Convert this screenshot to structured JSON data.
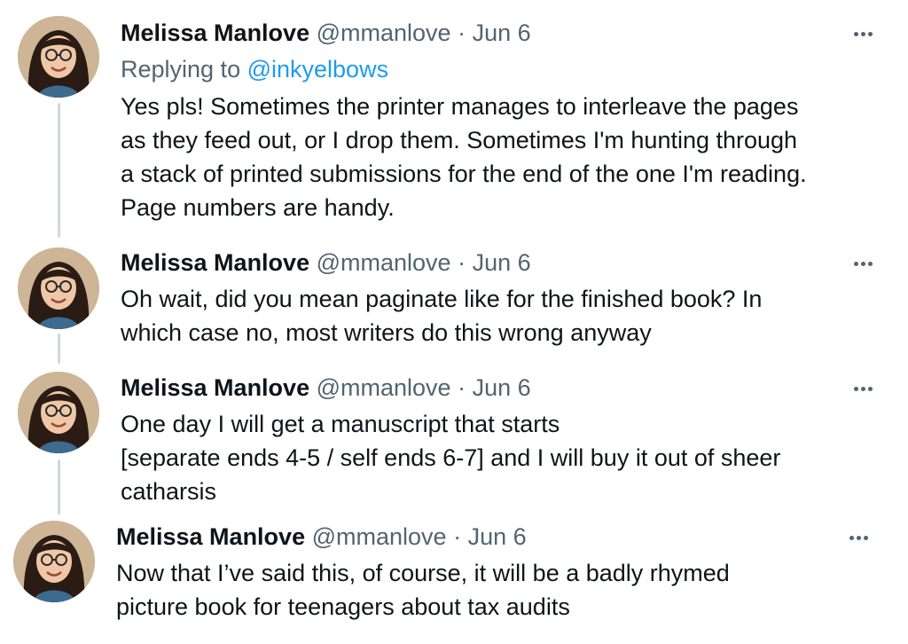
{
  "tweets": [
    {
      "name": "Melissa Manlove",
      "handle": "@mmanlove",
      "separator": "·",
      "date": "Jun 6",
      "replying_prefix": "Replying to ",
      "replying_mention": "@inkyelbows",
      "lines": [
        "Yes pls! Sometimes the printer manages to interleave the pages",
        "as they feed out, or I drop them. Sometimes I'm hunting through",
        "a stack of printed submissions for the end of the one I'm reading.",
        "Page numbers are handy."
      ]
    },
    {
      "name": "Melissa Manlove",
      "handle": "@mmanlove",
      "separator": "·",
      "date": "Jun 6",
      "lines": [
        "Oh wait, did you mean paginate like for the finished book? In",
        "which case no, most writers do this wrong anyway"
      ]
    },
    {
      "name": "Melissa Manlove",
      "handle": "@mmanlove",
      "separator": "·",
      "date": "Jun 6",
      "lines": [
        "One day I will get a manuscript that starts",
        "[separate ends 4-5 / self ends 6-7] and I will buy it out of sheer",
        "catharsis"
      ]
    },
    {
      "name": "Melissa Manlove",
      "handle": "@mmanlove",
      "separator": "·",
      "date": "Jun 6",
      "lines": [
        "Now that I’ve said this, of course, it will be a badly rhymed",
        "picture book for teenagers about tax audits"
      ]
    }
  ],
  "icons": {
    "more": "more-horizontal-icon",
    "avatar": "profile-photo"
  },
  "colors": {
    "text": "#0f1419",
    "secondary": "#536471",
    "mention": "#1d9bf0",
    "thread_line": "#cfd9de"
  }
}
